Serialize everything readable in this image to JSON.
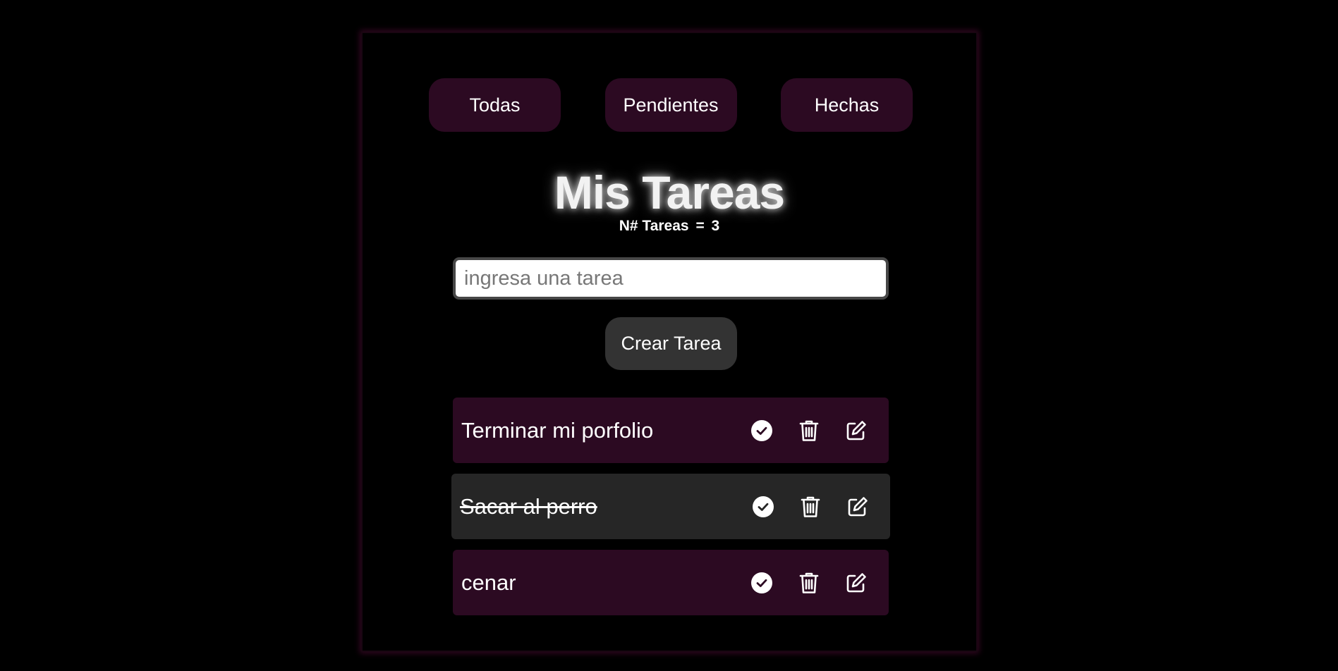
{
  "filters": [
    {
      "label": "Todas"
    },
    {
      "label": "Pendientes"
    },
    {
      "label": "Hechas"
    }
  ],
  "header": {
    "title": "Mis Tareas",
    "counter_label": "N# Tareas",
    "counter_sep": "=",
    "counter_value": "3"
  },
  "form": {
    "placeholder": "ingresa una tarea",
    "value": "",
    "create_label": "Crear Tarea"
  },
  "tasks": [
    {
      "text": "Terminar mi porfolio",
      "done": false
    },
    {
      "text": "Sacar al perro",
      "done": true
    },
    {
      "text": "cenar",
      "done": false
    }
  ],
  "icons": {
    "complete": "check-circle-icon",
    "delete": "trash-icon",
    "edit": "edit-icon"
  },
  "colors": {
    "background": "#000000",
    "accent": "#2c0a22",
    "done_row": "#262626",
    "create_button": "#333333"
  }
}
